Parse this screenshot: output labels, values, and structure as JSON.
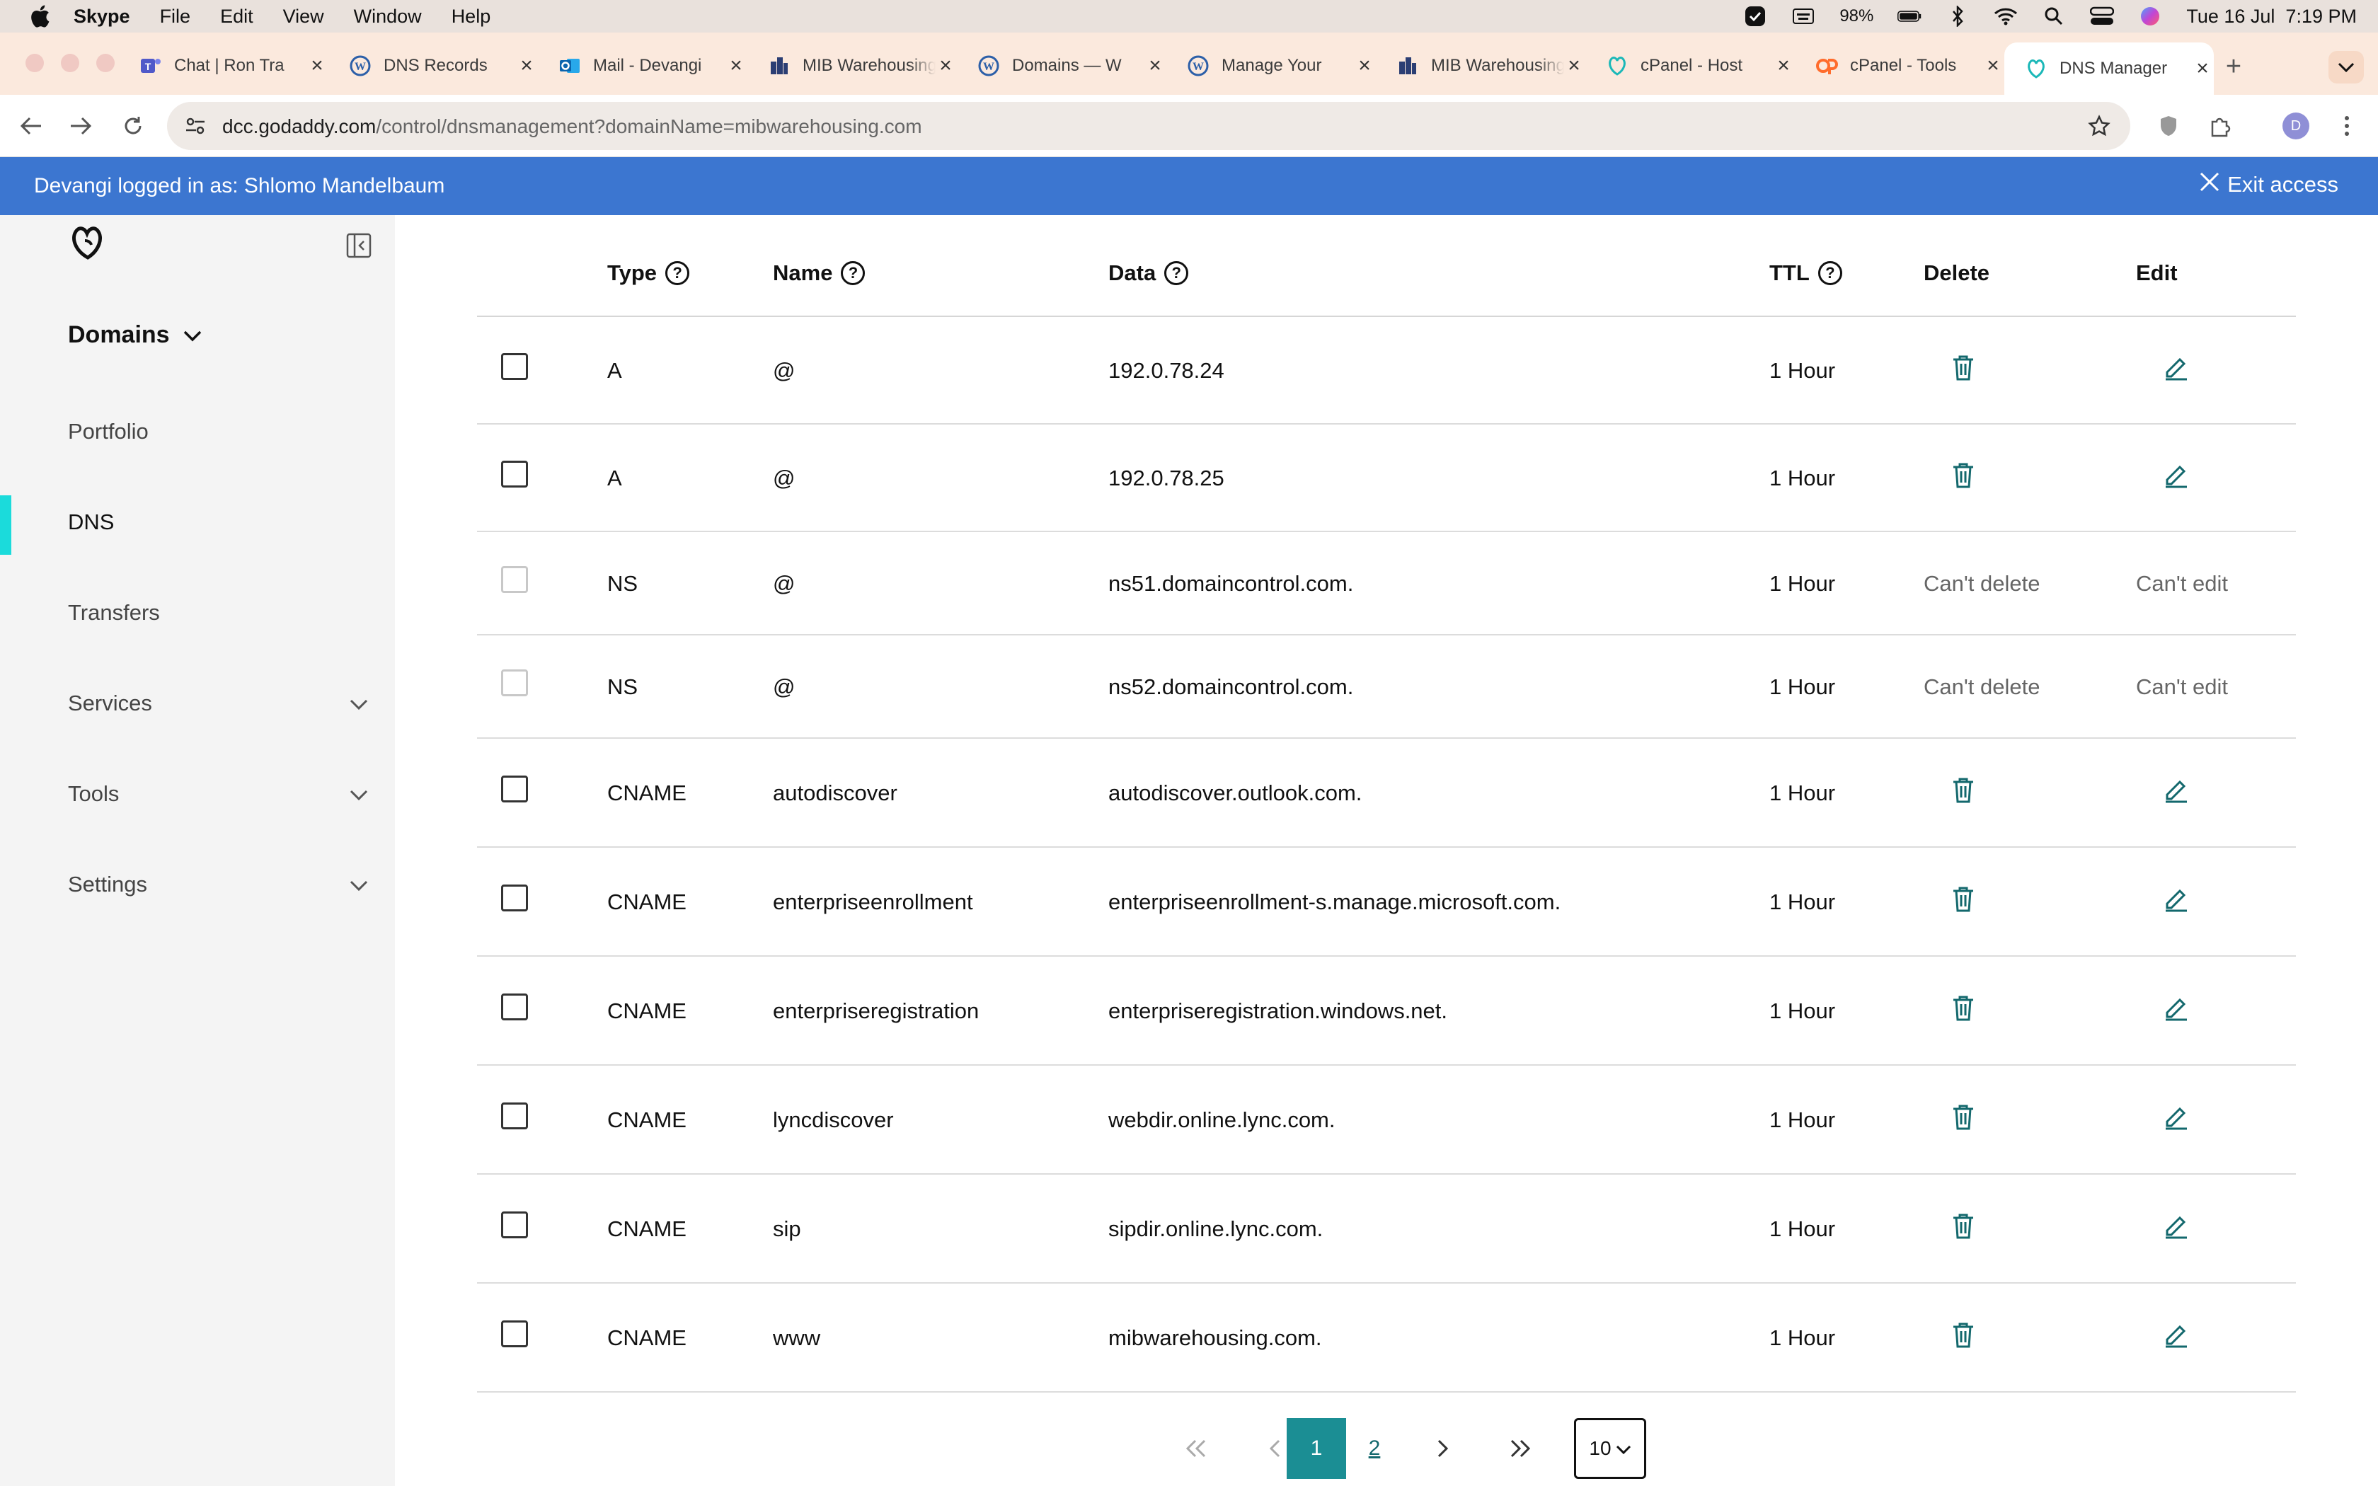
{
  "menubar": {
    "app": "Skype",
    "items": [
      "File",
      "Edit",
      "View",
      "Window",
      "Help"
    ],
    "battery": "98%",
    "datetime": "Tue 16 Jul  7:19 PM"
  },
  "tabs": [
    {
      "label": "Chat | Ron Tra",
      "icon": "teams-icon"
    },
    {
      "label": "DNS Records",
      "icon": "wordpress-icon"
    },
    {
      "label": "Mail - Devangi",
      "icon": "outlook-icon"
    },
    {
      "label": "MIB Warehousing",
      "icon": "building-icon"
    },
    {
      "label": "Domains — W",
      "icon": "wordpress-icon"
    },
    {
      "label": "Manage Your",
      "icon": "wordpress-icon"
    },
    {
      "label": "MIB Warehousing",
      "icon": "building-icon"
    },
    {
      "label": "cPanel - Host",
      "icon": "godaddy-icon"
    },
    {
      "label": "cPanel - Tools",
      "icon": "cpanel-icon"
    },
    {
      "label": "DNS Manager",
      "icon": "godaddy-icon"
    }
  ],
  "address": {
    "host": "dcc.godaddy.com",
    "path": "/control/dnsmanagement?domainName=mibwarehousing.com"
  },
  "profile_initial": "D",
  "banner": {
    "text": "Devangi logged in as: Shlomo Mandelbaum",
    "exit": "Exit access"
  },
  "sidebar": {
    "section": "Domains",
    "items": [
      "Portfolio",
      "DNS",
      "Transfers",
      "Services",
      "Tools",
      "Settings"
    ]
  },
  "table": {
    "headers": {
      "type": "Type",
      "name": "Name",
      "data": "Data",
      "ttl": "TTL",
      "delete": "Delete",
      "edit": "Edit"
    },
    "rows": [
      {
        "type": "A",
        "name": "@",
        "data": "192.0.78.24",
        "ttl": "1 Hour",
        "locked": false
      },
      {
        "type": "A",
        "name": "@",
        "data": "192.0.78.25",
        "ttl": "1 Hour",
        "locked": false
      },
      {
        "type": "NS",
        "name": "@",
        "data": "ns51.domaincontrol.com.",
        "ttl": "1 Hour",
        "locked": true,
        "delete_text": "Can't delete",
        "edit_text": "Can't edit"
      },
      {
        "type": "NS",
        "name": "@",
        "data": "ns52.domaincontrol.com.",
        "ttl": "1 Hour",
        "locked": true,
        "delete_text": "Can't delete",
        "edit_text": "Can't edit"
      },
      {
        "type": "CNAME",
        "name": "autodiscover",
        "data": "autodiscover.outlook.com.",
        "ttl": "1 Hour",
        "locked": false
      },
      {
        "type": "CNAME",
        "name": "enterpriseenrollment",
        "data": "enterpriseenrollment-s.manage.microsoft.com.",
        "ttl": "1 Hour",
        "locked": false
      },
      {
        "type": "CNAME",
        "name": "enterpriseregistration",
        "data": "enterpriseregistration.windows.net.",
        "ttl": "1 Hour",
        "locked": false
      },
      {
        "type": "CNAME",
        "name": "lyncdiscover",
        "data": "webdir.online.lync.com.",
        "ttl": "1 Hour",
        "locked": false
      },
      {
        "type": "CNAME",
        "name": "sip",
        "data": "sipdir.online.lync.com.",
        "ttl": "1 Hour",
        "locked": false
      },
      {
        "type": "CNAME",
        "name": "www",
        "data": "mibwarehousing.com.",
        "ttl": "1 Hour",
        "locked": false
      }
    ]
  },
  "pagination": {
    "pages": [
      "1",
      "2"
    ],
    "current": "1",
    "page_size": "10"
  },
  "colors": {
    "banner": "#3c76d0",
    "accent": "#1b8e94",
    "sidebar_active": "#1bdbdb",
    "icon_teal": "#13686d"
  }
}
